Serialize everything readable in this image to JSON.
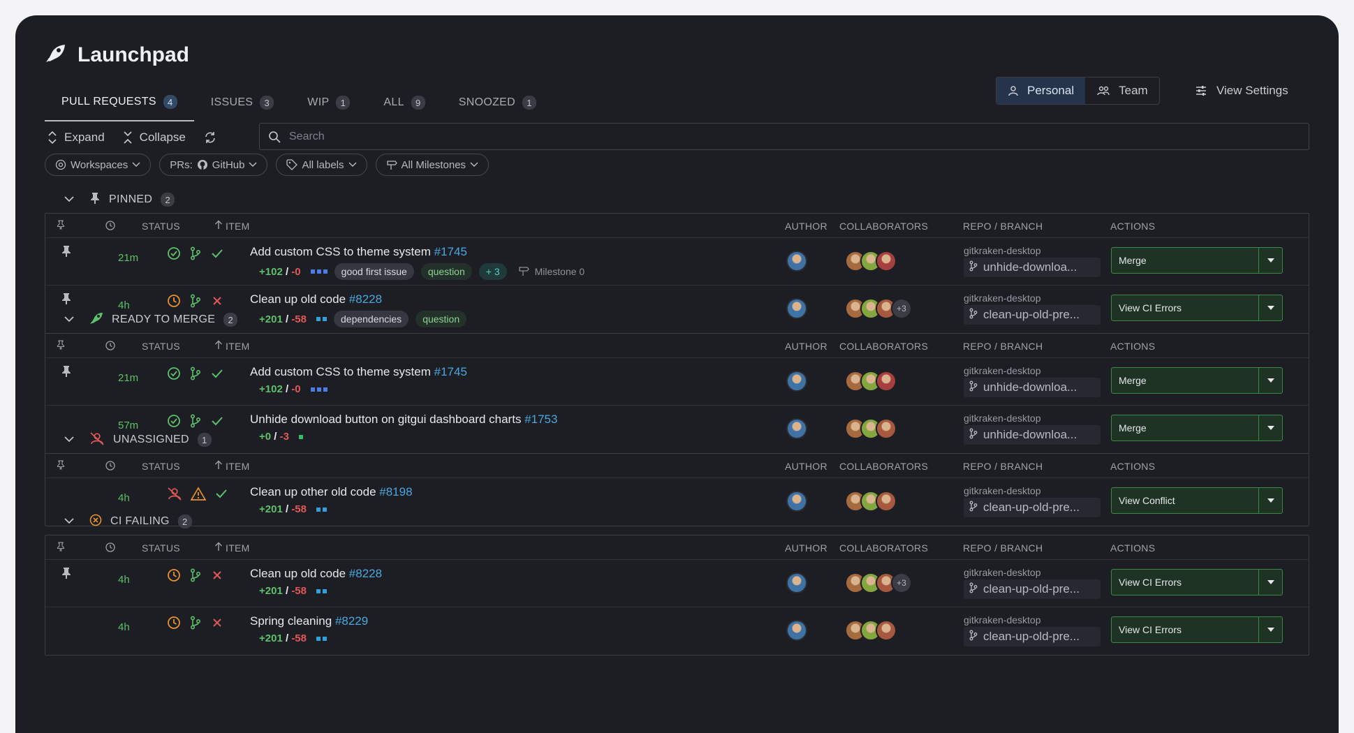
{
  "app": {
    "title": "Launchpad"
  },
  "tabs": [
    {
      "label": "PULL REQUESTS",
      "count": "4"
    },
    {
      "label": "ISSUES",
      "count": "3"
    },
    {
      "label": "WIP",
      "count": "1"
    },
    {
      "label": "ALL",
      "count": "9"
    },
    {
      "label": "SNOOZED",
      "count": "1"
    }
  ],
  "scope": {
    "personal": "Personal",
    "team": "Team"
  },
  "view_settings": "View Settings",
  "toolbar": {
    "expand": "Expand",
    "collapse": "Collapse"
  },
  "search": {
    "placeholder": "Search"
  },
  "filters": {
    "workspaces": "Workspaces",
    "prs_prefix": "PRs:",
    "prs_provider": "GitHub",
    "labels": "All labels",
    "milestones": "All Milestones"
  },
  "columns": {
    "status": "STATUS",
    "item": "ITEM",
    "author": "AUTHOR",
    "collaborators": "COLLABORATORS",
    "repo_branch": "REPO / BRANCH",
    "actions": "ACTIONS"
  },
  "colors": {
    "accent_green": "#5dc06a",
    "deletion_red": "#e25858",
    "link_blue": "#4aa8e0",
    "warning_orange": "#e8922e"
  },
  "sections": [
    {
      "name": "PINNED",
      "count": "2",
      "icon": "pin-icon",
      "rows": [
        {
          "pinned": true,
          "time": "21m",
          "status": [
            "check-circle-icon",
            "branch-icon",
            "checkmark-icon"
          ],
          "title": "Add custom CSS to theme system",
          "number": "#1745",
          "add": "+102",
          "del": "-0",
          "bars": [
            "blue",
            "blue",
            "blue"
          ],
          "tags": [
            {
              "text": "good first issue",
              "style": "grey"
            },
            {
              "text": "question",
              "style": "green"
            },
            {
              "text": "+ 3",
              "style": "teal"
            }
          ],
          "milestone": "Milestone 0",
          "collab_more": "",
          "repo": "gitkraken-desktop",
          "branch": "unhide-downloa...",
          "action": "Merge"
        },
        {
          "pinned": true,
          "time": "4h",
          "status": [
            "clock-icon",
            "branch-icon",
            "x-icon"
          ],
          "title": "Clean up old code",
          "number": "#8228",
          "add": "+201",
          "del": "-58",
          "bars": [
            "cyan",
            "cyan"
          ],
          "tags": [
            {
              "text": "dependencies",
              "style": "grey"
            },
            {
              "text": "question",
              "style": "green"
            }
          ],
          "milestone": "",
          "collab_more": "+3",
          "repo": "gitkraken-desktop",
          "branch": "clean-up-old-pre...",
          "action": "View CI Errors"
        }
      ]
    },
    {
      "name": "READY TO MERGE",
      "count": "2",
      "icon": "rocket-icon",
      "rows": [
        {
          "pinned": true,
          "time": "21m",
          "status": [
            "check-circle-icon",
            "branch-icon",
            "checkmark-icon"
          ],
          "title": "Add custom CSS to theme system",
          "number": "#1745",
          "add": "+102",
          "del": "-0",
          "bars": [
            "blue",
            "blue",
            "blue"
          ],
          "tags": [],
          "milestone": "",
          "collab_more": "",
          "repo": "gitkraken-desktop",
          "branch": "unhide-downloa...",
          "action": "Merge"
        },
        {
          "pinned": false,
          "time": "57m",
          "status": [
            "check-circle-icon",
            "branch-icon",
            "checkmark-icon"
          ],
          "title": "Unhide download button on gitgui dashboard charts",
          "number": "#1753",
          "add": "+0",
          "del": "-3",
          "bars": [
            "green"
          ],
          "tags": [],
          "milestone": "",
          "collab_more": "",
          "repo": "gitkraken-desktop",
          "branch": "unhide-downloa...",
          "action": "Merge"
        }
      ]
    },
    {
      "name": "UNASSIGNED",
      "count": "1",
      "icon": "unassigned-user-icon",
      "rows": [
        {
          "pinned": false,
          "time": "4h",
          "status": [
            "unassigned-user-icon",
            "warning-icon",
            "checkmark-icon"
          ],
          "title": "Clean up other old code",
          "number": "#8198",
          "add": "+201",
          "del": "-58",
          "bars": [
            "cyan",
            "cyan"
          ],
          "tags": [],
          "milestone": "",
          "collab_more": "",
          "repo": "gitkraken-desktop",
          "branch": "clean-up-old-pre...",
          "action": "View Conflict"
        }
      ]
    },
    {
      "name": "CI FAILING",
      "count": "2",
      "icon": "ci-failing-icon",
      "rows": [
        {
          "pinned": true,
          "time": "4h",
          "status": [
            "clock-icon",
            "branch-icon",
            "x-icon"
          ],
          "title": "Clean up old code",
          "number": "#8228",
          "add": "+201",
          "del": "-58",
          "bars": [
            "cyan",
            "cyan"
          ],
          "tags": [],
          "milestone": "",
          "collab_more": "+3",
          "repo": "gitkraken-desktop",
          "branch": "clean-up-old-pre...",
          "action": "View CI Errors"
        },
        {
          "pinned": false,
          "time": "4h",
          "status": [
            "clock-icon",
            "branch-icon",
            "x-icon"
          ],
          "title": "Spring cleaning",
          "number": "#8229",
          "add": "+201",
          "del": "-58",
          "bars": [
            "cyan",
            "cyan"
          ],
          "tags": [],
          "milestone": "",
          "collab_more": "",
          "repo": "gitkraken-desktop",
          "branch": "clean-up-old-pre...",
          "action": "View CI Errors"
        }
      ]
    }
  ]
}
